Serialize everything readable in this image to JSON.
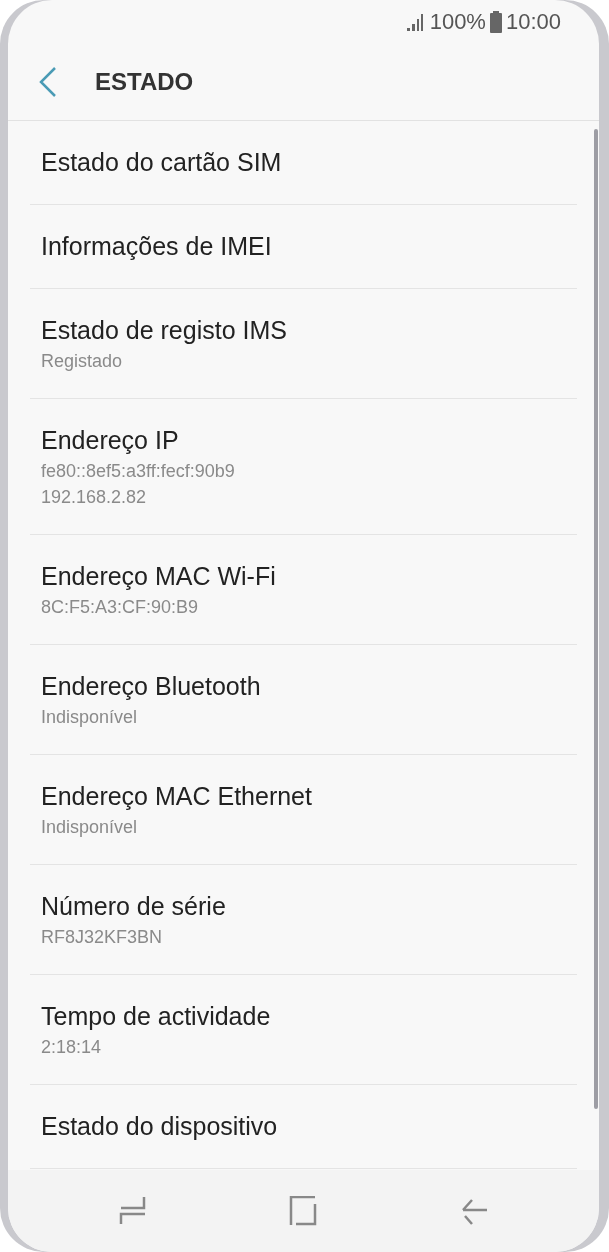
{
  "status_bar": {
    "battery": "100%",
    "time": "10:00"
  },
  "header": {
    "title": "ESTADO"
  },
  "items": [
    {
      "title": "Estado do cartão SIM"
    },
    {
      "title": "Informações de IMEI"
    },
    {
      "title": "Estado de registo IMS",
      "lines": [
        "Registado"
      ]
    },
    {
      "title": "Endereço IP",
      "lines": [
        "fe80::8ef5:a3ff:fecf:90b9",
        "192.168.2.82"
      ]
    },
    {
      "title": "Endereço MAC Wi-Fi",
      "lines": [
        "8C:F5:A3:CF:90:B9"
      ]
    },
    {
      "title": "Endereço Bluetooth",
      "lines": [
        "Indisponível"
      ]
    },
    {
      "title": "Endereço MAC Ethernet",
      "lines": [
        "Indisponível"
      ]
    },
    {
      "title": "Número de série",
      "lines": [
        "RF8J32KF3BN"
      ]
    },
    {
      "title": "Tempo de actividade",
      "lines": [
        "2:18:14"
      ]
    },
    {
      "title": "Estado do dispositivo"
    }
  ]
}
